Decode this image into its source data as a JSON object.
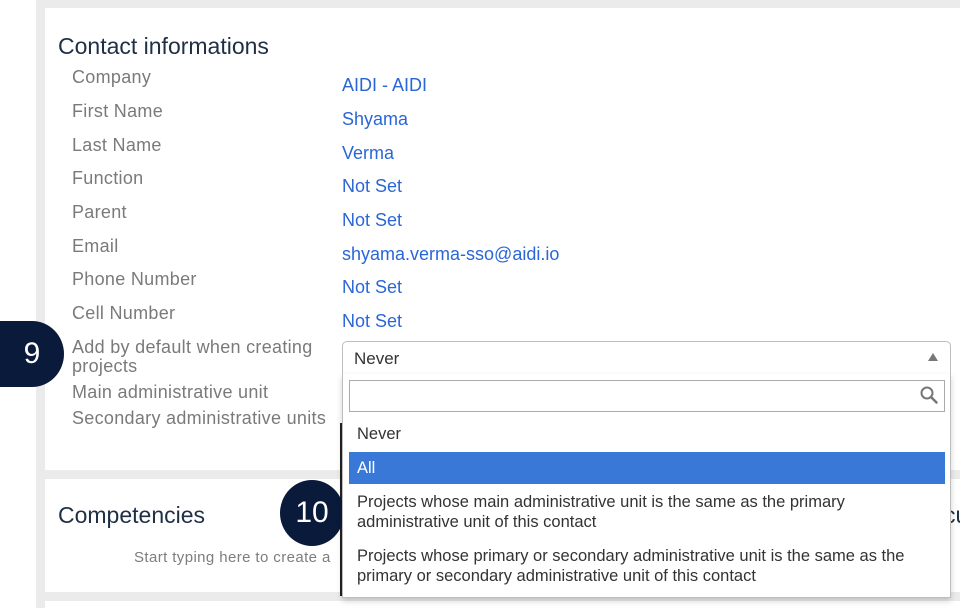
{
  "contact": {
    "title": "Contact informations",
    "fields": [
      {
        "label": "Company",
        "value": "AIDI - AIDI"
      },
      {
        "label": "First Name",
        "value": "Shyama"
      },
      {
        "label": "Last Name",
        "value": "Verma"
      },
      {
        "label": "Function",
        "value": "Not Set"
      },
      {
        "label": "Parent",
        "value": "Not Set"
      },
      {
        "label": "Email",
        "value": "shyama.verma-sso@aidi.io"
      },
      {
        "label": "Phone Number",
        "value": "Not Set"
      },
      {
        "label": "Cell Number",
        "value": "Not Set"
      }
    ],
    "add_default_label": "Add by default when creating projects",
    "main_unit_label": "Main administrative unit",
    "secondary_units_label": "Secondary administrative units",
    "select": {
      "value": "Never",
      "options": [
        "Never",
        "All",
        "Projects whose main administrative unit is the same as the primary administrative unit of this contact",
        "Projects whose primary or secondary administrative unit is the same as the primary or secondary administrative unit of this contact"
      ],
      "highlighted": "All"
    }
  },
  "competencies": {
    "title": "Competencies",
    "hint": "Start typing here to create a",
    "clipped_right_title": "cu"
  },
  "annotations": {
    "step_9": "9",
    "step_10": "10"
  },
  "colors": {
    "accent": "#2a66d6",
    "highlight": "#3a78d8",
    "badge": "#0a1a3a"
  }
}
